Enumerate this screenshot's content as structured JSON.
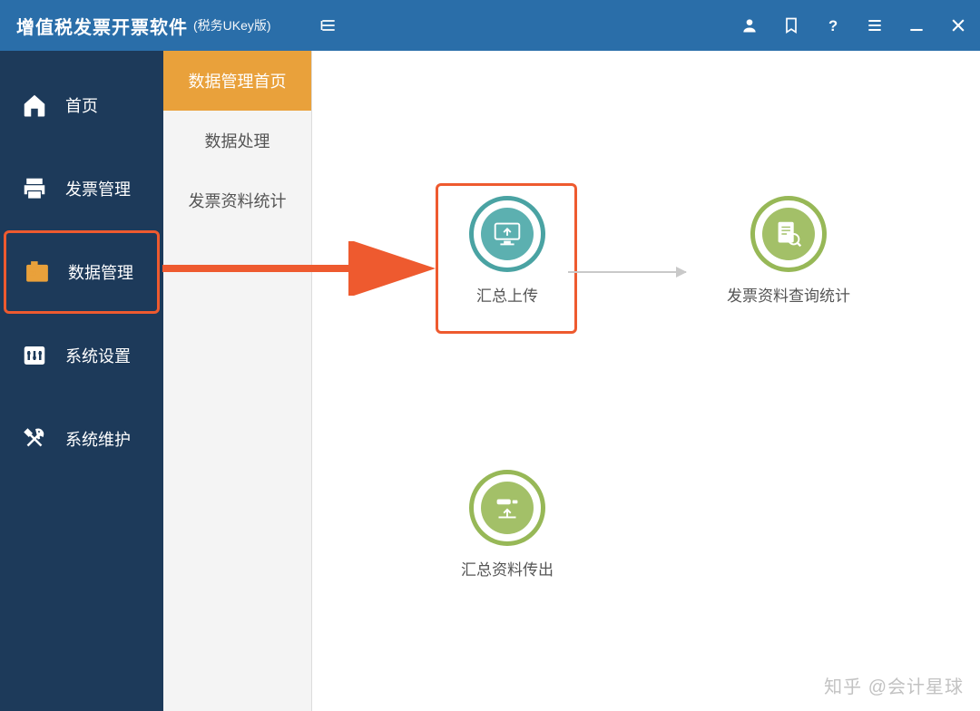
{
  "app": {
    "title": "增值税发票开票软件",
    "subtitle": "(税务UKey版)"
  },
  "sidebar1": {
    "items": [
      {
        "label": "首页",
        "icon": "home-icon"
      },
      {
        "label": "发票管理",
        "icon": "printer-icon"
      },
      {
        "label": "数据管理",
        "icon": "folder-icon",
        "highlighted": true
      },
      {
        "label": "系统设置",
        "icon": "settings-icon"
      },
      {
        "label": "系统维护",
        "icon": "tools-icon"
      }
    ]
  },
  "sidebar2": {
    "items": [
      {
        "label": "数据管理首页",
        "active": true
      },
      {
        "label": "数据处理"
      },
      {
        "label": "发票资料统计"
      }
    ]
  },
  "content": {
    "actions": [
      {
        "label": "汇总上传",
        "color": "teal",
        "icon": "upload-monitor-icon",
        "highlighted": true
      },
      {
        "label": "发票资料查询统计",
        "color": "green",
        "icon": "document-search-icon"
      },
      {
        "label": "汇总资料传出",
        "color": "green",
        "icon": "export-icon"
      }
    ]
  },
  "watermark": "知乎 @会计星球"
}
